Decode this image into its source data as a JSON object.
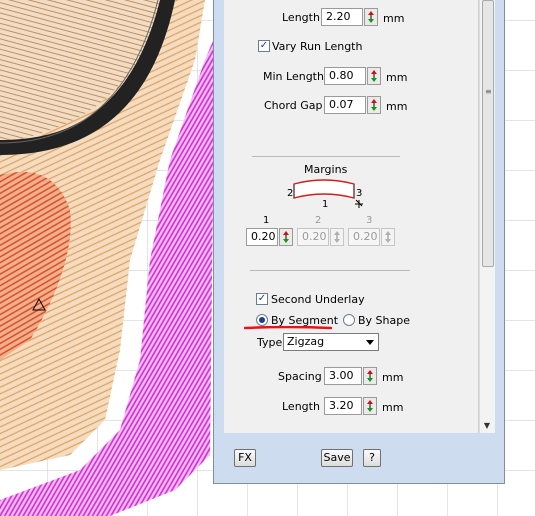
{
  "run": {
    "length_label": "Length",
    "length_value": "2.20",
    "length_unit": "mm",
    "vary_label": "Vary Run Length",
    "vary_checked": true,
    "min_length_label": "Min Length",
    "min_length_value": "0.80",
    "min_length_unit": "mm",
    "chord_gap_label": "Chord Gap",
    "chord_gap_value": "0.07",
    "chord_gap_unit": "mm"
  },
  "margins": {
    "title": "Margins",
    "diagram_labels": [
      "2",
      "1",
      "3"
    ],
    "columns": [
      {
        "label": "1",
        "value": "0.20",
        "enabled": true
      },
      {
        "label": "2",
        "value": "0.20",
        "enabled": false
      },
      {
        "label": "3",
        "value": "0.20",
        "enabled": false
      }
    ]
  },
  "underlay": {
    "second_label": "Second Underlay",
    "second_checked": true,
    "by_segment_label": "By Segment",
    "by_shape_label": "By Shape",
    "selected": "By Segment",
    "type_label": "Type",
    "type_value": "Zigzag",
    "spacing_label": "Spacing",
    "spacing_value": "3.00",
    "spacing_unit": "mm",
    "length_label": "Length",
    "length_value": "3.20",
    "length_unit": "mm"
  },
  "footer": {
    "fx_label": "FX",
    "save_label": "Save",
    "help_label": "?"
  },
  "colors": {
    "panel_bg": "#cddcee",
    "annotation_red": "#e8141c",
    "embroidery_magenta": "#d824d8",
    "embroidery_orange": "#e0a060",
    "embroidery_dark": "#1a1a1a"
  },
  "icons": [
    "spin-arrows-icon",
    "checkmark-icon",
    "dropdown-arrow-icon",
    "margin-shape-icon",
    "triangle-marker-icon"
  ]
}
